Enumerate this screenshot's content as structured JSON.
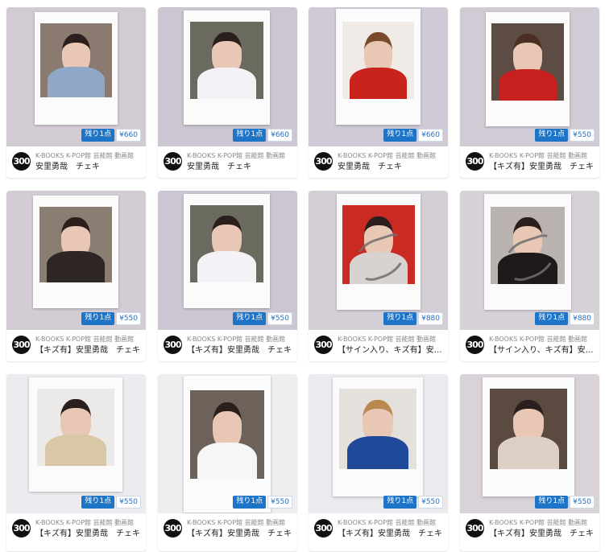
{
  "shop": {
    "logo_text": "300",
    "name": "K-BOOKS K-POP館 芸能館 動画館"
  },
  "stock_label": "残り1点",
  "items": [
    {
      "price": "¥660",
      "title": "安里勇哉　チェキ"
    },
    {
      "price": "¥660",
      "title": "安里勇哉　チェキ"
    },
    {
      "price": "¥660",
      "title": "安里勇哉　チェキ"
    },
    {
      "price": "¥550",
      "title": "【キズ有】安里勇哉　チェキ"
    },
    {
      "price": "¥550",
      "title": "【キズ有】安里勇哉　チェキ"
    },
    {
      "price": "¥550",
      "title": "【キズ有】安里勇哉　チェキ"
    },
    {
      "price": "¥880",
      "title": "【サイン入り、キズ有】安里勇哉　チェキ"
    },
    {
      "price": "¥880",
      "title": "【サイン入り、キズ有】安里勇哉　チェキ"
    },
    {
      "price": "¥550",
      "title": "【キズ有】安里勇哉　チェキ"
    },
    {
      "price": "¥550",
      "title": "【キズ有】安里勇哉　チェキ"
    },
    {
      "price": "¥550",
      "title": "【キズ有】安里勇哉　チェキ"
    },
    {
      "price": "¥550",
      "title": "【キズ有】安里勇哉　チェキ"
    }
  ],
  "colors": {
    "stock_badge": "#1e74c7",
    "price_text": "#2270c2"
  }
}
